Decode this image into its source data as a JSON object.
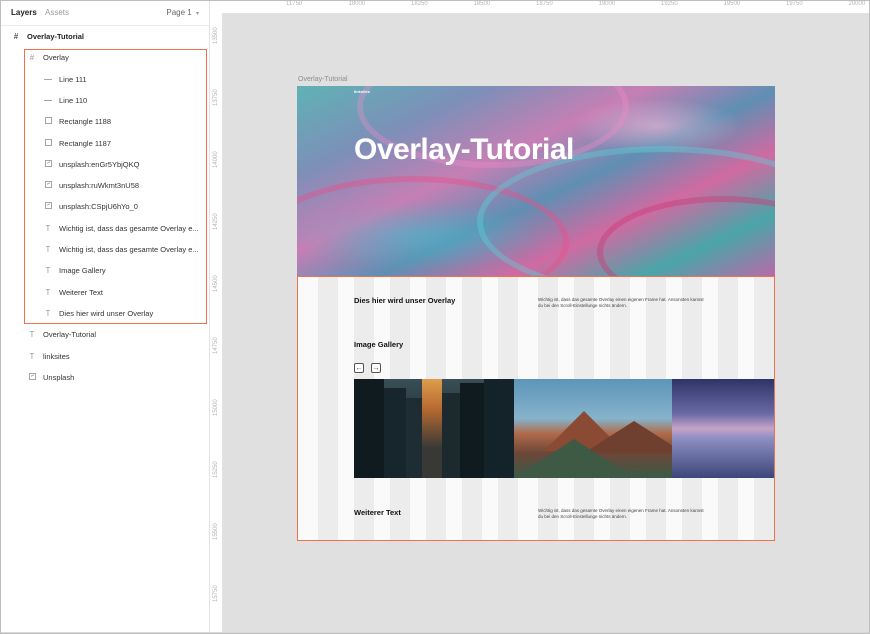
{
  "panel": {
    "tabs": {
      "layers": "Layers",
      "assets": "Assets"
    },
    "page_select": "Page 1",
    "layers": [
      {
        "label": "Overlay-Tutorial",
        "icon": "frame-icon",
        "level": 0
      },
      {
        "label": "Overlay",
        "icon": "frame-icon",
        "level": 1
      },
      {
        "label": "Line 111",
        "icon": "line-icon",
        "level": 2
      },
      {
        "label": "Line 110",
        "icon": "line-icon",
        "level": 2
      },
      {
        "label": "Rectangle 1188",
        "icon": "rectangle-icon",
        "level": 2
      },
      {
        "label": "Rectangle 1187",
        "icon": "rectangle-icon",
        "level": 2
      },
      {
        "label": "unsplash:enGr5YbjQKQ",
        "icon": "image-icon",
        "level": 2
      },
      {
        "label": "unsplash:ruWkmt3nU58",
        "icon": "image-icon",
        "level": 2
      },
      {
        "label": "unsplash:CSpjU6hYo_0",
        "icon": "image-icon",
        "level": 2
      },
      {
        "label": "Wichtig ist, dass das gesamte Overlay e...",
        "icon": "text-icon",
        "level": 2
      },
      {
        "label": "Wichtig ist, dass das gesamte Overlay e...",
        "icon": "text-icon",
        "level": 2
      },
      {
        "label": "Image Gallery",
        "icon": "text-icon",
        "level": 2
      },
      {
        "label": "Weiterer Text",
        "icon": "text-icon",
        "level": 2
      },
      {
        "label": "Dies hier wird unser Overlay",
        "icon": "text-icon",
        "level": 2
      },
      {
        "label": "Overlay-Tutorial",
        "icon": "text-icon",
        "level": 1
      },
      {
        "label": "linksites",
        "icon": "text-icon",
        "level": 1
      },
      {
        "label": "Unsplash",
        "icon": "image-icon",
        "level": 1
      }
    ]
  },
  "rulers": {
    "top": [
      "11750",
      "18000",
      "18250",
      "18500",
      "18750",
      "19000",
      "19250",
      "19500",
      "19750",
      "20000"
    ],
    "left": [
      "13500",
      "13750",
      "14000",
      "14250",
      "14500",
      "14750",
      "15000",
      "15250",
      "15500",
      "15750"
    ]
  },
  "canvas": {
    "frame_label": "Overlay-Tutorial",
    "hero": {
      "logo": "linksites",
      "title": "Overlay-Tutorial"
    },
    "overlay": {
      "heading": "Dies  hier wird unser Overlay",
      "body_1": "Wichtig ist, dass das gesamte Overlay einen eigenen Frame hat. Ansonsten kannst du bei den Scroll-Einstellunge nichts ändern.",
      "gallery_title": "Image Gallery",
      "prev": "←",
      "next": "→",
      "more_heading": "Weiterer Text",
      "body_2": "Wichtig ist, dass das gesamte Overlay einen eigenen Frame hat. Ansonsten kannst du bei den Scroll-Einstellunge nichts ändern."
    }
  },
  "colors": {
    "selection": "#f0714a",
    "canvas": "#e0e0e0"
  }
}
